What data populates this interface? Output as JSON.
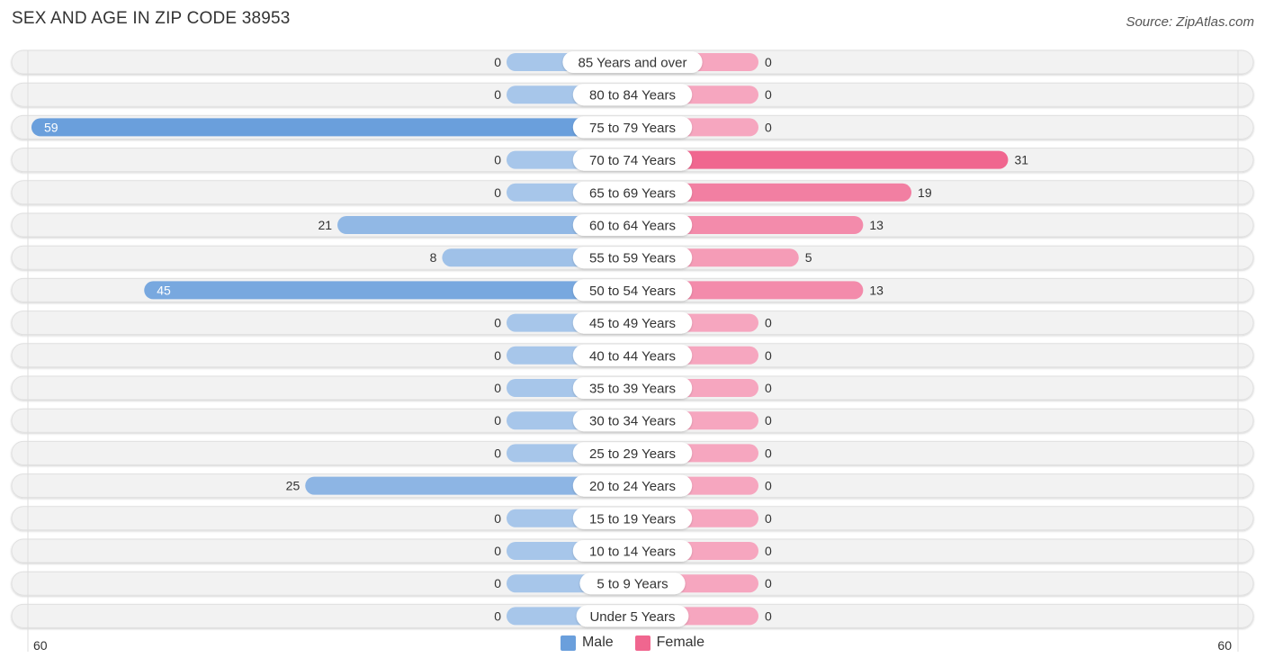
{
  "header": {
    "title": "SEX AND AGE IN ZIP CODE 38953",
    "source": "Source: ZipAtlas.com"
  },
  "legend": {
    "male_label": "Male",
    "female_label": "Female"
  },
  "colors": {
    "male": "#6a9fdc",
    "male_light": "#a7c6ea",
    "female": "#f0668f",
    "female_light": "#f6a6bf",
    "row_bg": "#f2f2f2",
    "text": "#333333"
  },
  "chart_data": {
    "type": "bar",
    "orientation": "horizontal-butterfly",
    "title": "SEX AND AGE IN ZIP CODE 38953",
    "categories": [
      "85 Years and over",
      "80 to 84 Years",
      "75 to 79 Years",
      "70 to 74 Years",
      "65 to 69 Years",
      "60 to 64 Years",
      "55 to 59 Years",
      "50 to 54 Years",
      "45 to 49 Years",
      "40 to 44 Years",
      "35 to 39 Years",
      "30 to 34 Years",
      "25 to 29 Years",
      "20 to 24 Years",
      "15 to 19 Years",
      "10 to 14 Years",
      "5 to 9 Years",
      "Under 5 Years"
    ],
    "series": [
      {
        "name": "Male",
        "values": [
          0,
          0,
          59,
          0,
          0,
          21,
          8,
          45,
          0,
          0,
          0,
          0,
          0,
          25,
          0,
          0,
          0,
          0
        ]
      },
      {
        "name": "Female",
        "values": [
          0,
          0,
          0,
          31,
          19,
          13,
          5,
          13,
          0,
          0,
          0,
          0,
          0,
          0,
          0,
          0,
          0,
          0
        ]
      }
    ],
    "axis": {
      "left_label": "60",
      "right_label": "60",
      "range": [
        -60,
        60
      ]
    },
    "legend_position": "bottom-center",
    "grid": false
  }
}
